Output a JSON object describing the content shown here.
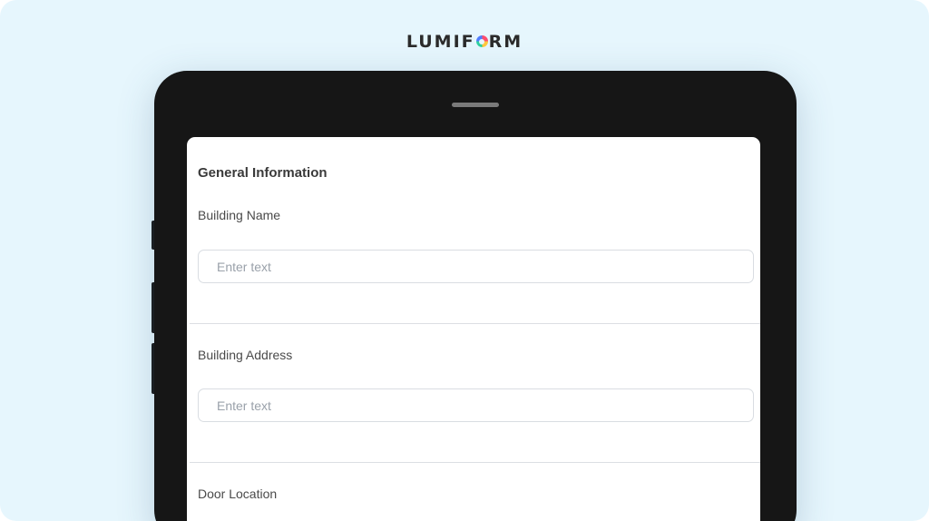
{
  "brand": {
    "logo_part1": "LUMIF",
    "logo_part2": "RM",
    "logo_icon": "color-ring-icon"
  },
  "form": {
    "section_title": "General Information",
    "fields": [
      {
        "label": "Building Name",
        "placeholder": "Enter text",
        "value": ""
      },
      {
        "label": "Building Address",
        "placeholder": "Enter text",
        "value": ""
      },
      {
        "label": "Door Location"
      }
    ]
  },
  "colors": {
    "background": "#e6f6fd",
    "device": "#161616",
    "screen": "#ffffff",
    "input_border": "#d9dde2"
  }
}
